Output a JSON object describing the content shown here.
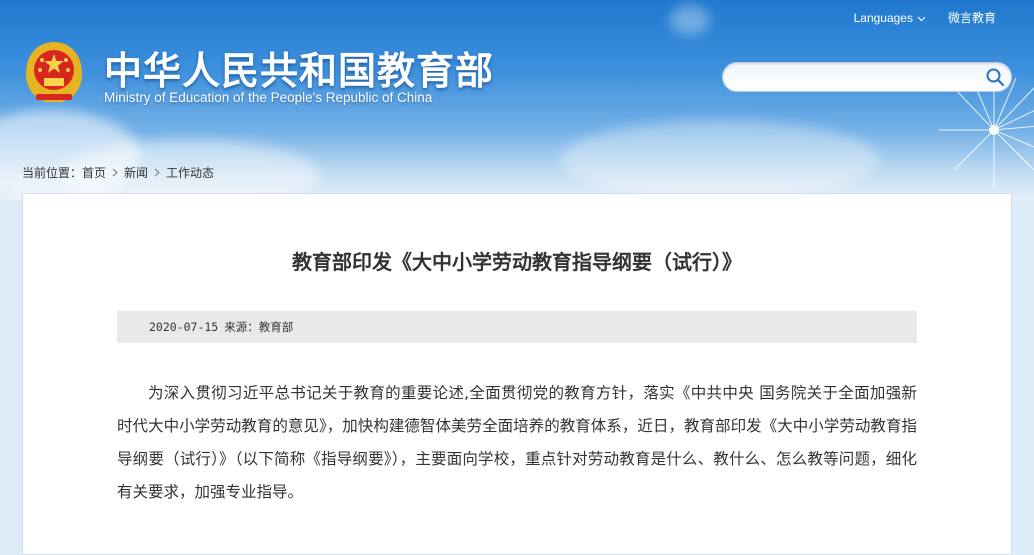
{
  "header": {
    "title_cn": "中华人民共和国教育部",
    "title_en": "Ministry of Education of the People's Republic of China",
    "links": {
      "languages": "Languages",
      "weibo": "微言教育"
    },
    "search": {
      "value": "",
      "placeholder": ""
    }
  },
  "breadcrumb": {
    "prefix": "当前位置：",
    "items": [
      "首页",
      "新闻",
      "工作动态"
    ]
  },
  "article": {
    "title": "教育部印发《大中小学劳动教育指导纲要（试行）》",
    "date": "2020-07-15",
    "source": "来源：教育部",
    "paragraph": "为深入贯彻习近平总书记关于教育的重要论述,全面贯彻党的教育方针，落实《中共中央 国务院关于全面加强新时代大中小学劳动教育的意见》，加快构建德智体美劳全面培养的教育体系，近日，教育部印发《大中小学劳动教育指导纲要（试行）》（以下简称《指导纲要》），主要面向学校，重点针对劳动教育是什么、教什么、怎么教等问题，细化有关要求，加强专业指导。"
  },
  "icons": [
    "national-emblem-icon",
    "search-icon",
    "chevron-down-icon",
    "chevron-right-icon",
    "dandelion-decoration"
  ],
  "colors": {
    "sky_top": "#1f78cf",
    "text": "#333333",
    "meta_bg": "#e9e9e9"
  }
}
